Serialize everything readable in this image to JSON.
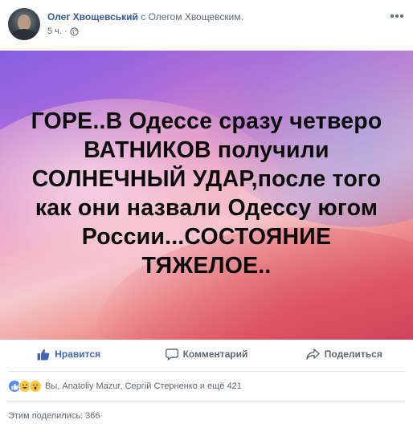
{
  "post": {
    "author": "Олег Хвощевський",
    "with_text": "с Олегом Хвощевским.",
    "time": "5 ч.",
    "privacy_icon": "globe-icon",
    "more_icon": "more-dots-icon"
  },
  "image": {
    "text_lines": [
      "ГОРЕ..В Одессе сразу четверо",
      "ВАТНИКОВ получили",
      "СОЛНЕЧНЫЙ УДАР,после того",
      "как они назвали Одессу югом",
      "России...СОСТОЯНИЕ",
      "ТЯЖЕЛОЕ.."
    ],
    "colors": {
      "violet": "#7e5ce0",
      "pink": "#f2b7c5",
      "coral": "#e25f6a",
      "text": "#0b0b0b"
    }
  },
  "actions": {
    "like": {
      "label": "Нравится",
      "icon": "thumbs-up-icon",
      "color": "#4267b2"
    },
    "comment": {
      "label": "Комментарий",
      "icon": "comment-icon"
    },
    "share": {
      "label": "Поделиться",
      "icon": "share-arrow-icon"
    }
  },
  "reactions": {
    "icons": [
      "like-reaction-icon",
      "haha-reaction-icon",
      "wow-reaction-icon"
    ],
    "summary": "Вы, Anatoliy Mazur, Сергій Стерненко и ещё 421"
  },
  "shares": {
    "text": "Этим поделились: 366"
  },
  "colors": {
    "link": "#385898",
    "secondary_text": "#606770",
    "divider": "#dadde1"
  }
}
